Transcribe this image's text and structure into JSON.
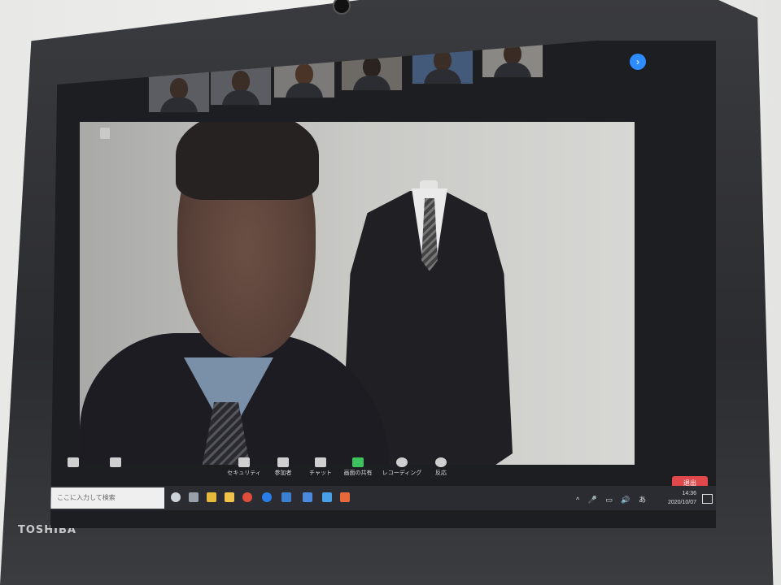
{
  "device": {
    "brand": "TOSHIBA"
  },
  "gallery": {
    "thumbs": [
      {
        "name": ""
      },
      {
        "name": ""
      },
      {
        "name": ""
      },
      {
        "name": ""
      },
      {
        "name": ""
      },
      {
        "name": ""
      }
    ],
    "more_label": "›"
  },
  "active_speaker": {
    "name_tag": "",
    "footer_label": ""
  },
  "toolbar": {
    "items": [
      {
        "label": "",
        "icon": "mic-icon"
      },
      {
        "label": "",
        "icon": "video-icon"
      },
      {
        "label": "セキュリティ",
        "icon": "shield-icon"
      },
      {
        "label": "参加者",
        "icon": "participants-icon"
      },
      {
        "label": "チャット",
        "icon": "chat-icon"
      },
      {
        "label": "画面の共有",
        "icon": "share-screen-icon"
      },
      {
        "label": "レコーディング",
        "icon": "record-icon"
      },
      {
        "label": "反応",
        "icon": "reaction-icon"
      }
    ],
    "end_label": "退出"
  },
  "taskbar": {
    "search_placeholder": "ここに入力して検索",
    "tray_symbols": "^ 🎤 ▭ 🔊 あ",
    "time": "14:36",
    "date": "2020/10/07"
  },
  "colors": {
    "accent": "#2d8cff",
    "end": "#e0484c"
  }
}
